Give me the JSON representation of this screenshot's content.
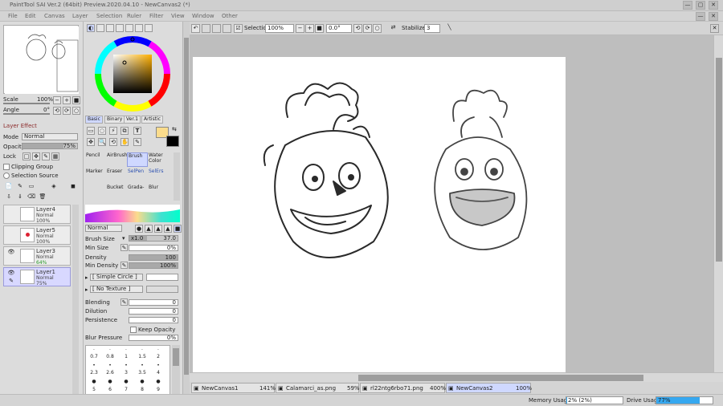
{
  "window": {
    "title": "PaintTool SAI Ver.2 (64bit) Preview.2020.04.10 - NewCanvas2 (*)",
    "controls": [
      "—",
      "▢",
      "✕"
    ]
  },
  "menu": [
    "File",
    "Edit",
    "Canvas",
    "Layer",
    "Selection",
    "Ruler",
    "Filter",
    "View",
    "Window",
    "Other"
  ],
  "toolbar": {
    "selection_label": "Selection",
    "zoom": "100%",
    "rotation": "0.0°",
    "stabilizer_label": "Stabilizer",
    "stabilizer_value": "3"
  },
  "navigator": {
    "scale_label": "Scale",
    "scale_value": "100%",
    "angle_label": "Angle",
    "angle_value": "0°"
  },
  "layer_panel": {
    "title": "Layer Effect",
    "mode_label": "Mode",
    "mode_value": "Normal",
    "opacity_label": "Opacity",
    "opacity_value": "75%",
    "lock_label": "Lock",
    "clipping_group": "Clipping Group",
    "selection_source": "Selection Source",
    "layers": [
      {
        "name": "Layer4",
        "mode": "Normal",
        "opacity": "100%"
      },
      {
        "name": "Layer5",
        "mode": "Normal",
        "opacity": "100%"
      },
      {
        "name": "Layer3",
        "mode": "Normal",
        "opacity": "64%"
      },
      {
        "name": "Layer1",
        "mode": "Normal",
        "opacity": "75%"
      }
    ]
  },
  "color_tabs": [
    "Basic",
    "Binary",
    "Ver.1",
    "Artistic"
  ],
  "brush_tools": [
    {
      "label": "Pencil"
    },
    {
      "label": "AirBrush"
    },
    {
      "label": "Brush"
    },
    {
      "label": "Water Color"
    },
    {
      "label": "Marker"
    },
    {
      "label": "Eraser"
    },
    {
      "label": "SelPen"
    },
    {
      "label": "SelErs"
    },
    {
      "label": ""
    },
    {
      "label": "Bucket"
    },
    {
      "label": "Grada-"
    },
    {
      "label": "Blur"
    }
  ],
  "brush_settings": {
    "blend_mode": "Normal",
    "size_label": "Brush Size",
    "size_mult": "x1.0",
    "size_value": "37.0",
    "min_size_label": "Min Size",
    "min_size_value": "0%",
    "density_label": "Density",
    "density_value": "100",
    "min_density_label": "Min Density",
    "min_density_value": "100%",
    "shape": "[ Simple Circle ]",
    "texture": "[ No Texture ]",
    "blending_label": "Blending",
    "blending_value": "0",
    "dilution_label": "Dilution",
    "dilution_value": "0",
    "persistence_label": "Persistence",
    "persistence_value": "0",
    "keep_opacity": "Keep Opacity",
    "blur_pressure_label": "Blur Pressure",
    "blur_pressure_value": "0%"
  },
  "brush_sizes": [
    [
      "0.7",
      "0.8",
      "1",
      "1.5",
      "2"
    ],
    [
      "2.3",
      "2.6",
      "3",
      "3.5",
      "4"
    ],
    [
      "5",
      "6",
      "7",
      "8",
      "9"
    ]
  ],
  "canvas_tabs": [
    {
      "name": "NewCanvas1",
      "zoom": "141%"
    },
    {
      "name": "Calamarci_as.png",
      "zoom": "59%"
    },
    {
      "name": "rl22ntg6rbo71.png",
      "zoom": "400%"
    },
    {
      "name": "NewCanvas2",
      "zoom": "100%"
    }
  ],
  "status": {
    "memory_label": "Memory Usage",
    "memory_value": "2% (2%)",
    "memory_fraction": 0.02,
    "drive_label": "Drive Usage",
    "drive_value": "77%",
    "drive_fraction": 0.77
  },
  "colors": {
    "primary": "#fbdc8c",
    "secondary": "#000000",
    "selection_blue": "#cfd8ff",
    "drive_bar": "#36a8f0"
  }
}
